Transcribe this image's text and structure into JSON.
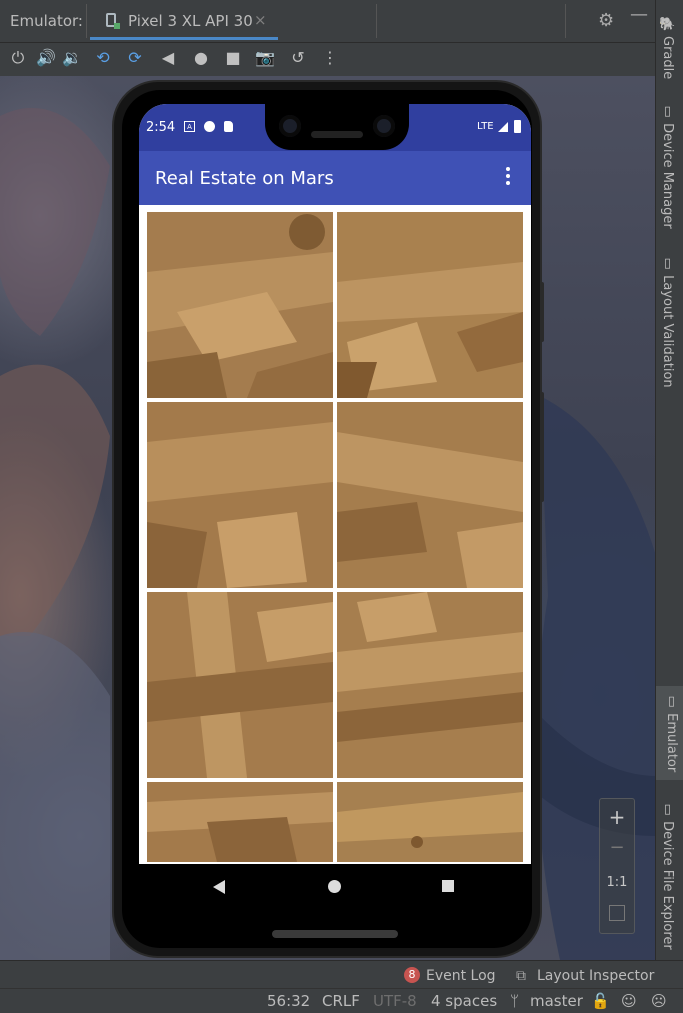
{
  "header": {
    "emulator_label": "Emulator:",
    "device_tab": "Pixel 3 XL API 30",
    "tab_close": "×"
  },
  "toolbar_icons": [
    "power-icon",
    "volume-up-icon",
    "volume-down-icon",
    "rotate-left-icon",
    "rotate-right-icon",
    "back-icon",
    "home-icon",
    "overview-icon",
    "screenshot-icon",
    "snapshot-icon",
    "more-icon"
  ],
  "right_strip": {
    "items": [
      "Gradle",
      "Device Manager",
      "Layout Validation",
      "Emulator",
      "Device File Explorer"
    ],
    "selected": "Emulator"
  },
  "zoom": {
    "plus": "+",
    "minus": "−",
    "one_to_one": "1:1"
  },
  "phone": {
    "status_time": "2:54",
    "network": "LTE",
    "app_title": "Real Estate on Mars",
    "colors": {
      "primary": "#3f51b5",
      "primary_dark": "#303f9f"
    }
  },
  "tool_windows": {
    "event_log_count": "8",
    "event_log": "Event Log",
    "layout_inspector": "Layout Inspector"
  },
  "status_line": {
    "position": "56:32",
    "line_sep": "CRLF",
    "encoding": "UTF-8",
    "indent": "4 spaces",
    "branch": "master"
  }
}
